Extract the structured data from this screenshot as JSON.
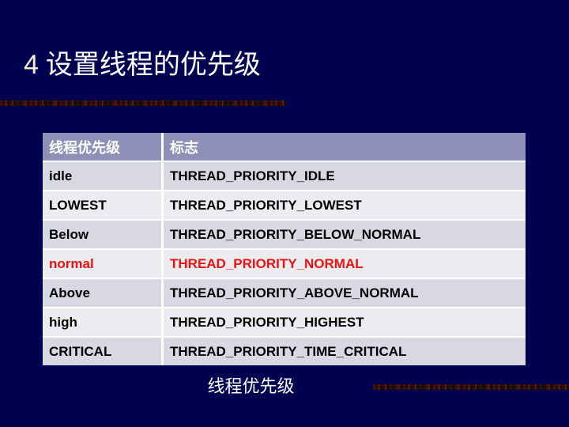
{
  "slide": {
    "title_number": "4",
    "title_text": "设置线程的优先级",
    "caption": "线程优先级",
    "background_color": "#000050",
    "title_number_color": "#f2ecd2",
    "title_color": "#ffffff"
  },
  "table": {
    "header_bg": "#8e90b8",
    "accent_color": "#ee1111",
    "row_dark_bg": "#d7d8e1",
    "row_light_bg": "#ececf0",
    "headers": {
      "name": "线程优先级",
      "flag": "标志"
    },
    "rows": [
      {
        "name": "idle",
        "flag": "THREAD_PRIORITY_IDLE",
        "highlight": false
      },
      {
        "name": "LOWEST",
        "flag": "THREAD_PRIORITY_LOWEST",
        "highlight": false
      },
      {
        "name": "Below",
        "flag": "THREAD_PRIORITY_BELOW_NORMAL",
        "highlight": false
      },
      {
        "name": "normal",
        "flag": "THREAD_PRIORITY_NORMAL",
        "highlight": true
      },
      {
        "name": "Above",
        "flag": "THREAD_PRIORITY_ABOVE_NORMAL",
        "highlight": false
      },
      {
        "name": "high",
        "flag": "THREAD_PRIORITY_HIGHEST",
        "highlight": false
      },
      {
        "name": "CRITICAL",
        "flag": "THREAD_PRIORITY_TIME_CRITICAL",
        "highlight": false
      }
    ]
  }
}
